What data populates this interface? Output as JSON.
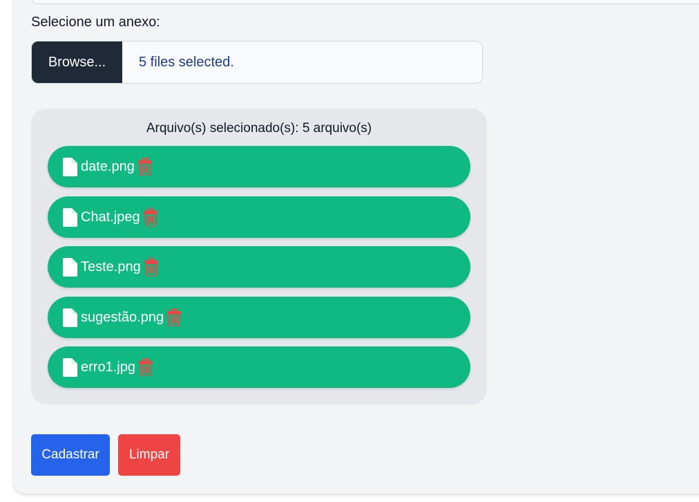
{
  "form": {
    "attachment_label": "Selecione um anexo:",
    "browse_label": "Browse...",
    "file_status": "5 files selected."
  },
  "files_panel": {
    "heading": "Arquivo(s) selecionado(s): 5 arquivo(s)",
    "files": [
      {
        "name": "date.png"
      },
      {
        "name": "Chat.jpeg"
      },
      {
        "name": "Teste.png"
      },
      {
        "name": "sugestão.png"
      },
      {
        "name": "erro1.jpg"
      }
    ]
  },
  "actions": {
    "submit_label": "Cadastrar",
    "clear_label": "Limpar"
  },
  "icons": {
    "file": "file-icon",
    "delete": "trash-icon"
  },
  "colors": {
    "pill": "#10b981",
    "trash": "#ef4444",
    "primary": "#2563eb",
    "danger": "#ef4444",
    "browse": "#1f2937"
  }
}
